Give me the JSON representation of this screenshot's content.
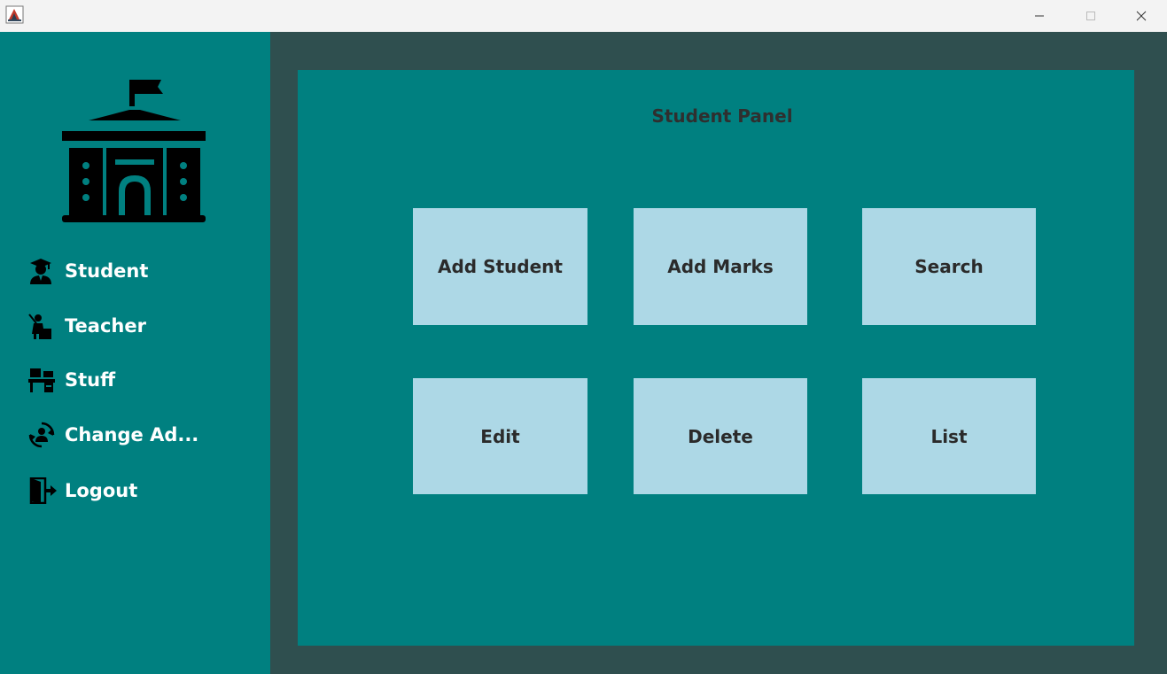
{
  "window": {
    "icons": {
      "app": "java-app-icon",
      "minimize": "minimize-icon",
      "maximize": "maximize-icon",
      "close": "close-icon"
    }
  },
  "sidebar": {
    "logo": "school-building-logo",
    "items": [
      {
        "label": "Student",
        "icon": "graduate-icon"
      },
      {
        "label": "Teacher",
        "icon": "teacher-icon"
      },
      {
        "label": "Stuff",
        "icon": "staff-desk-icon"
      },
      {
        "label": "Change Ad...",
        "icon": "change-admin-icon"
      },
      {
        "label": "Logout",
        "icon": "logout-icon"
      }
    ]
  },
  "panel": {
    "title": "Student Panel",
    "buttons": [
      {
        "label": "Add Student"
      },
      {
        "label": "Add Marks"
      },
      {
        "label": "Search"
      },
      {
        "label": "Edit"
      },
      {
        "label": "Delete"
      },
      {
        "label": "List"
      }
    ]
  },
  "colors": {
    "sidebar_bg": "#008080",
    "frame_bg": "#2f4f4f",
    "panel_bg": "#008080",
    "tile_bg": "#add8e6",
    "title_text": "#2f2f2f",
    "nav_text": "#ffffff"
  }
}
